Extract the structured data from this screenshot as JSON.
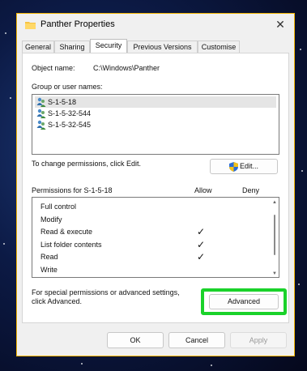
{
  "window": {
    "title": "Panther Properties",
    "close_glyph": "✕",
    "border_color": "#f2b400"
  },
  "tabs": [
    {
      "label": "General"
    },
    {
      "label": "Sharing"
    },
    {
      "label": "Security",
      "active": true
    },
    {
      "label": "Previous Versions"
    },
    {
      "label": "Customise"
    }
  ],
  "object": {
    "label": "Object name:",
    "value": "C:\\Windows\\Panther"
  },
  "groups": {
    "label": "Group or user names:",
    "items": [
      {
        "name": "S-1-5-18",
        "icon": "user-group-icon",
        "selected": true
      },
      {
        "name": "S-1-5-32-544",
        "icon": "user-group-icon"
      },
      {
        "name": "S-1-5-32-545",
        "icon": "user-group-icon"
      }
    ]
  },
  "change_hint": "To change permissions, click Edit.",
  "edit_button": {
    "label": "Edit...",
    "icon": "uac-shield-icon"
  },
  "permissions": {
    "title": "Permissions for S-1-5-18",
    "allow_header": "Allow",
    "deny_header": "Deny",
    "check_glyph": "✓",
    "rows": [
      {
        "name": "Full control",
        "allow": false,
        "deny": false
      },
      {
        "name": "Modify",
        "allow": false,
        "deny": false
      },
      {
        "name": "Read & execute",
        "allow": true,
        "deny": false
      },
      {
        "name": "List folder contents",
        "allow": true,
        "deny": false
      },
      {
        "name": "Read",
        "allow": true,
        "deny": false
      },
      {
        "name": "Write",
        "allow": false,
        "deny": false
      }
    ]
  },
  "advanced_hint_line1": "For special permissions or advanced settings,",
  "advanced_hint_line2": "click Advanced.",
  "advanced_button": {
    "label": "Advanced",
    "highlight_color": "#1ad22a"
  },
  "footer": {
    "ok": "OK",
    "cancel": "Cancel",
    "apply": "Apply"
  }
}
